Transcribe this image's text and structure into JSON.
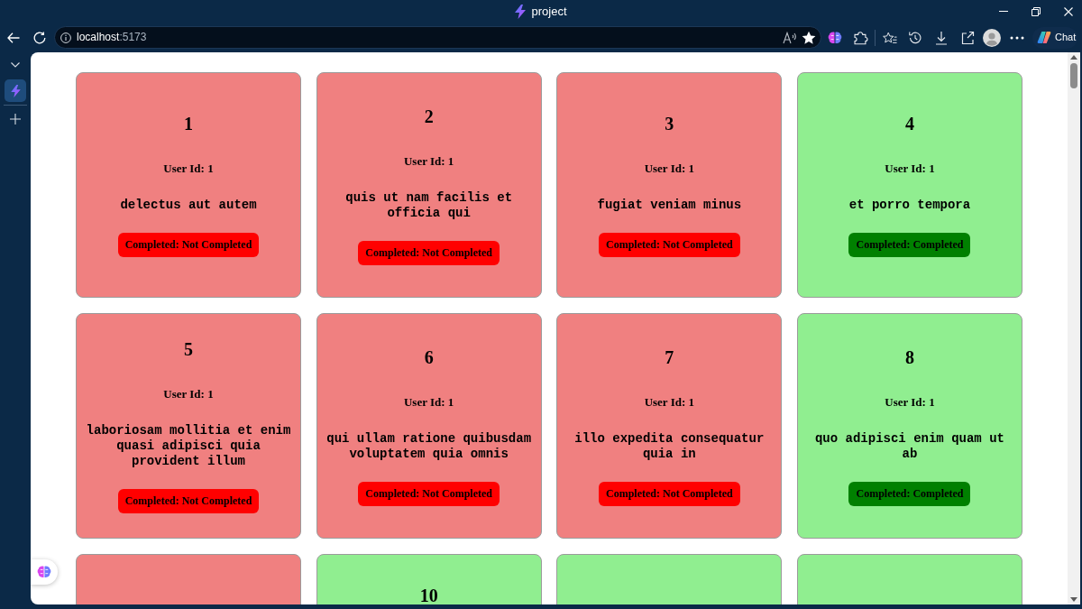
{
  "window": {
    "title": "project"
  },
  "address_bar": {
    "host": "localhost",
    "port": ":5173"
  },
  "toolbar": {
    "chat_button": "Chat"
  },
  "vertical_tabs": [
    {
      "selected": true
    }
  ],
  "todos": [
    {
      "id": "1",
      "user": "User Id: 1",
      "title": "delectus aut autem",
      "status": "Completed: Not Completed",
      "completed": false
    },
    {
      "id": "2",
      "user": "User Id: 1",
      "title": "quis ut nam facilis et officia qui",
      "status": "Completed: Not Completed",
      "completed": false
    },
    {
      "id": "3",
      "user": "User Id: 1",
      "title": "fugiat veniam minus",
      "status": "Completed: Not Completed",
      "completed": false
    },
    {
      "id": "4",
      "user": "User Id: 1",
      "title": "et porro tempora",
      "status": "Completed: Completed",
      "completed": true
    },
    {
      "id": "5",
      "user": "User Id: 1",
      "title": "laboriosam mollitia et enim quasi adipisci quia provident illum",
      "status": "Completed: Not Completed",
      "completed": false
    },
    {
      "id": "6",
      "user": "User Id: 1",
      "title": "qui ullam ratione quibusdam voluptatem quia omnis",
      "status": "Completed: Not Completed",
      "completed": false
    },
    {
      "id": "7",
      "user": "User Id: 1",
      "title": "illo expedita consequatur quia in",
      "status": "Completed: Not Completed",
      "completed": false
    },
    {
      "id": "8",
      "user": "User Id: 1",
      "title": "quo adipisci enim quam ut ab",
      "status": "Completed: Completed",
      "completed": true
    },
    {
      "completed": false
    },
    {
      "id": "10",
      "completed": true
    },
    {
      "completed": true
    },
    {
      "completed": true
    }
  ]
}
